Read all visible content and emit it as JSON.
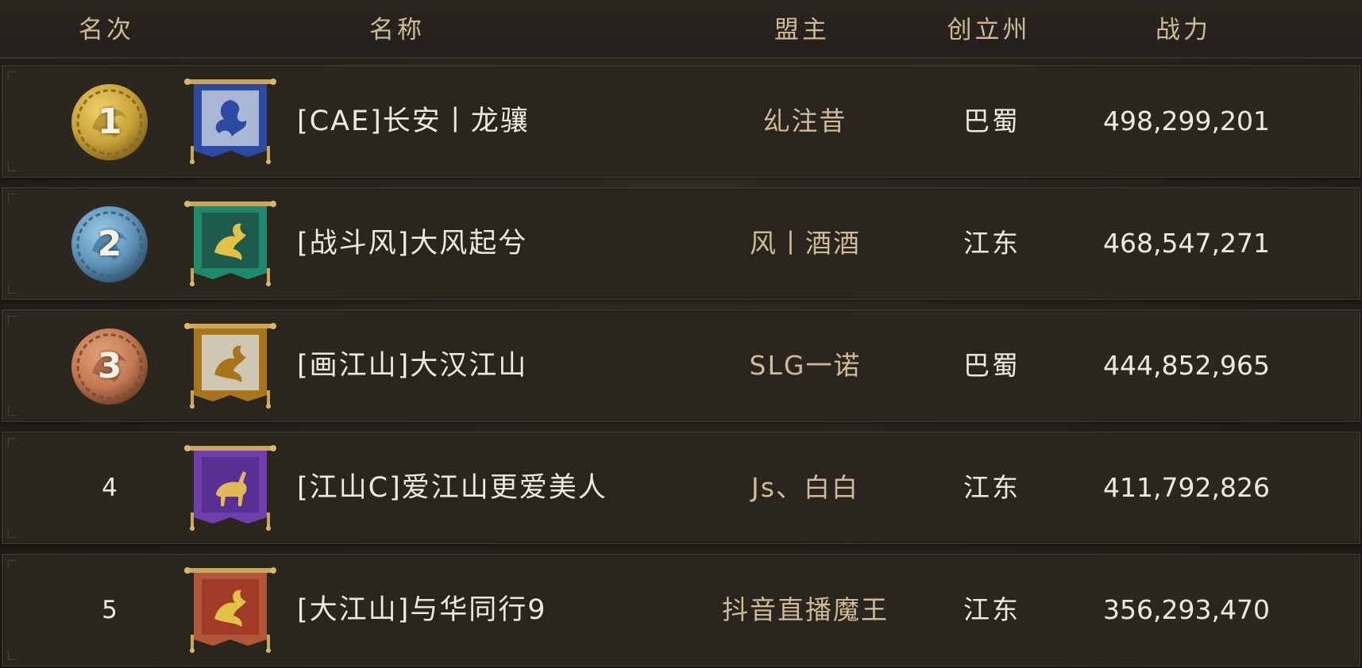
{
  "header": {
    "rank": "名次",
    "name": "名称",
    "leader": "盟主",
    "state": "创立州",
    "power": "战力"
  },
  "colors": {
    "gold_medal": "#c9a23a",
    "silver_medal": "#5f94b8",
    "bronze_medal": "#c27a52",
    "header_text": "#cdbb98",
    "row_text": "#efe9dd"
  },
  "rows": [
    {
      "rank": "1",
      "medal": "gold",
      "banner_icon": "phoenix-banner-icon",
      "banner_color": "#2c4aa0",
      "banner_panel": "#a9b6d6",
      "name": "[CAE]长安丨龙骧",
      "leader": "乣注昔",
      "state": "巴蜀",
      "power": "498,299,201"
    },
    {
      "rank": "2",
      "medal": "silver",
      "banner_icon": "dragon-banner-icon",
      "banner_color": "#1f8a6a",
      "banner_panel": "#1d5b4d",
      "name": "[战斗风]大风起兮",
      "leader": "风丨酒酒",
      "state": "江东",
      "power": "468,547,271"
    },
    {
      "rank": "3",
      "medal": "bronze",
      "banner_icon": "dragon-banner-icon",
      "banner_color": "#a8751d",
      "banner_panel": "#cfc7b2",
      "name": "[画江山]大汉江山",
      "leader": "SLG一诺",
      "state": "巴蜀",
      "power": "444,852,965"
    },
    {
      "rank": "4",
      "medal": "none",
      "banner_icon": "deer-banner-icon",
      "banner_color": "#6f3fb0",
      "banner_panel": "#5a2f93",
      "name": "[江山C]爱江山更爱美人",
      "leader": "Js、白白",
      "state": "江东",
      "power": "411,792,826"
    },
    {
      "rank": "5",
      "medal": "none",
      "banner_icon": "lion-banner-icon",
      "banner_color": "#b0573a",
      "banner_panel": "#a03b28",
      "name": "[大江山]与华同行9",
      "leader": "抖音直播魔王",
      "state": "江东",
      "power": "356,293,470"
    }
  ]
}
